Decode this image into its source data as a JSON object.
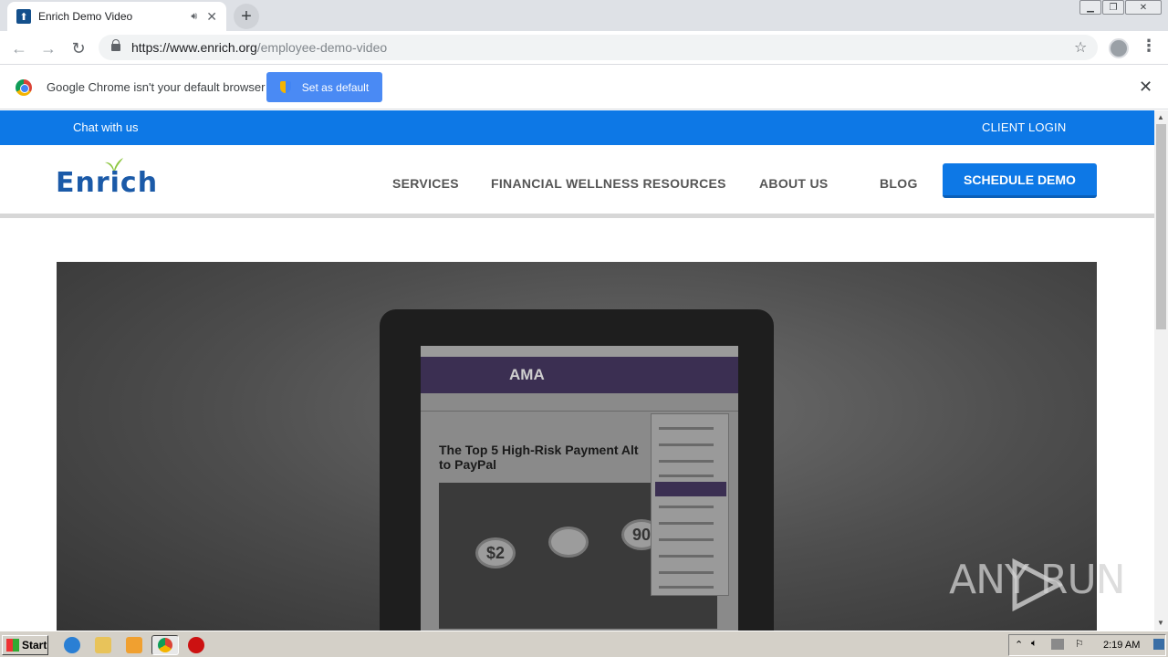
{
  "browser": {
    "tab_title": "Enrich Demo Video",
    "new_tab_symbol": "+",
    "url_host": "https://www.enrich.org",
    "url_path": "/employee-demo-video",
    "infobar_text": "Google Chrome isn't your default browser",
    "set_default_label": "Set as default"
  },
  "site": {
    "chat_label": "Chat with us",
    "client_login_label": "CLIENT LOGIN",
    "logo_text": "Enrich",
    "nav": [
      "SERVICES",
      "FINANCIAL WELLNESS RESOURCES",
      "ABOUT US",
      "BLOG"
    ],
    "schedule_demo_label": "SCHEDULE DEMO",
    "brand_blue": "#0d78e6"
  },
  "video": {
    "ama_text": "AMA",
    "article_title": "The Top 5 High-Risk Payment Alt to PayPal",
    "coins": [
      "$2",
      "90"
    ]
  },
  "watermark": "ANY RUN",
  "taskbar": {
    "start_label": "Start",
    "clock": "2:19 AM"
  }
}
